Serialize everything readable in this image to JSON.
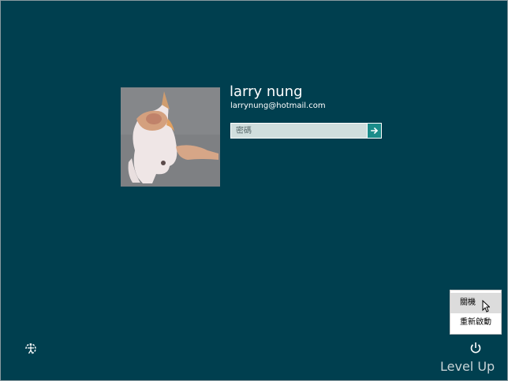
{
  "user": {
    "name": "larry nung",
    "email": "larrynung@hotmail.com"
  },
  "password": {
    "placeholder": "密碼",
    "value": ""
  },
  "power_menu": {
    "items": [
      {
        "label": "關機"
      },
      {
        "label": "重新啟動"
      }
    ]
  },
  "icons": {
    "submit": "arrow-right-icon",
    "ease_of_access": "ease-of-access-icon",
    "power": "power-icon",
    "cursor": "mouse-pointer-icon"
  },
  "colors": {
    "background": "#003f4f",
    "submit_button": "#1b8c8a",
    "password_field": "#d0dedd",
    "menu_hover": "#dcdcdc"
  },
  "watermark": "Level Up"
}
